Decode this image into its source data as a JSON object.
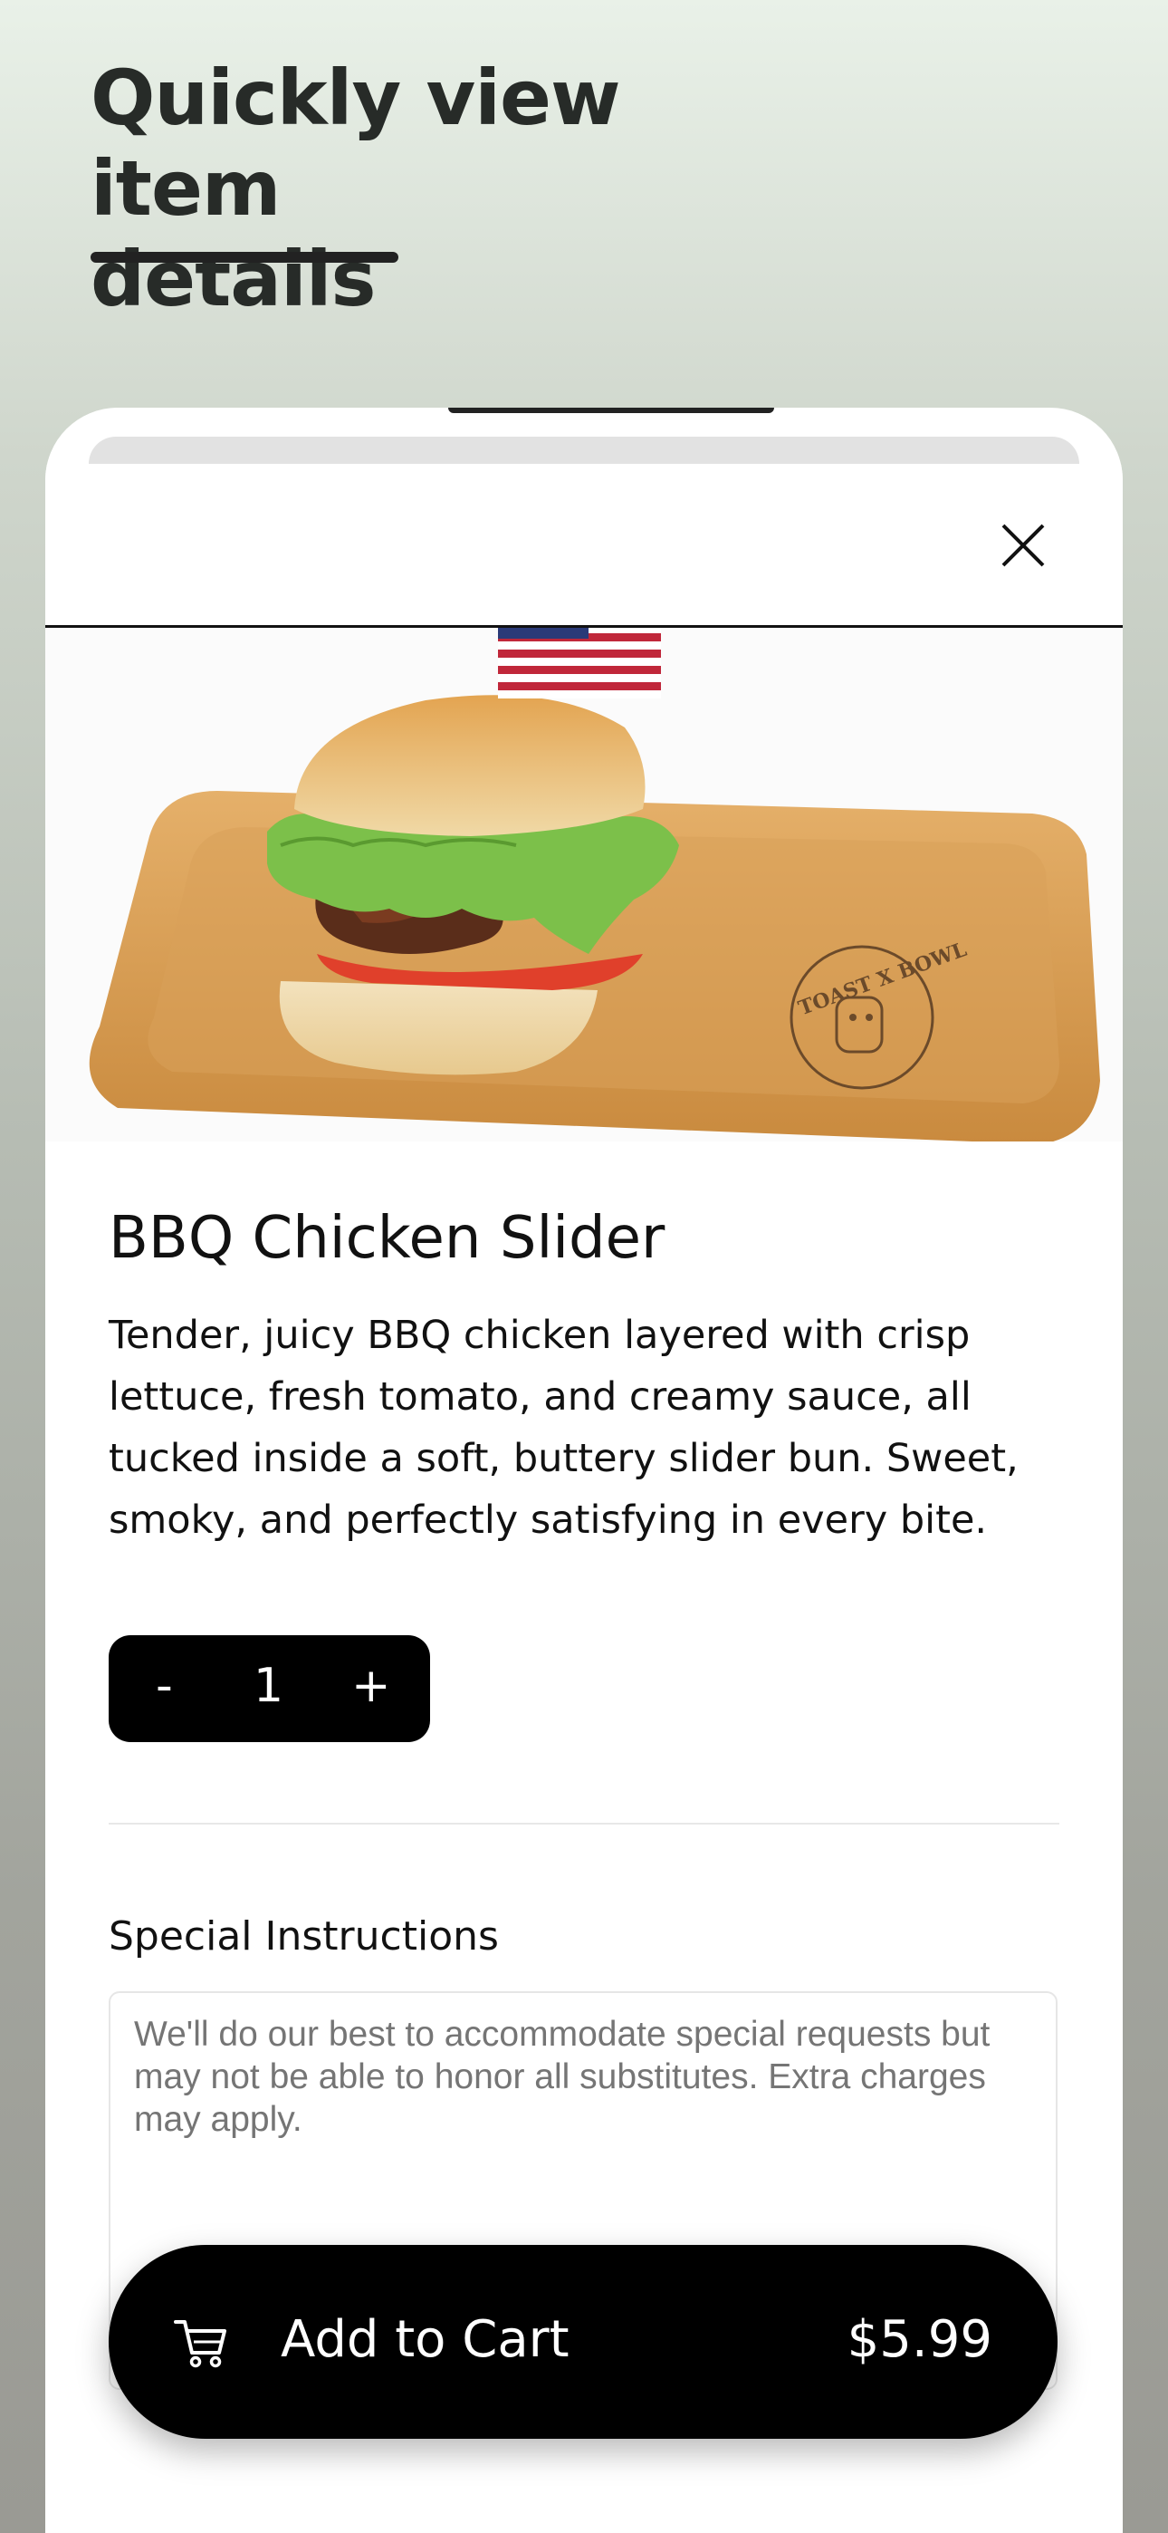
{
  "headline": {
    "line1": "Quickly view item",
    "line2": "details"
  },
  "item": {
    "name": "BBQ Chicken Slider",
    "description": "Tender, juicy BBQ chicken layered with crisp lettuce, fresh tomato, and creamy sauce, all tucked inside a soft, buttery slider bun. Sweet, smoky, and perfectly satisfying in every bite.",
    "tray_brand": "TOAST X BOWL"
  },
  "quantity": {
    "minus_label": "-",
    "value": "1",
    "plus_label": "+"
  },
  "special_instructions": {
    "label": "Special Instructions",
    "placeholder": "We'll do our best to accommodate special requests but may not be able to honor all substitutes. Extra charges may apply."
  },
  "cart": {
    "label": "Add to Cart",
    "price": "$5.99",
    "icon": "cart-icon"
  },
  "icons": {
    "close": "close-icon"
  },
  "colors": {
    "button_bg": "#000000",
    "button_text": "#ffffff",
    "sheet_bg": "#ffffff"
  }
}
